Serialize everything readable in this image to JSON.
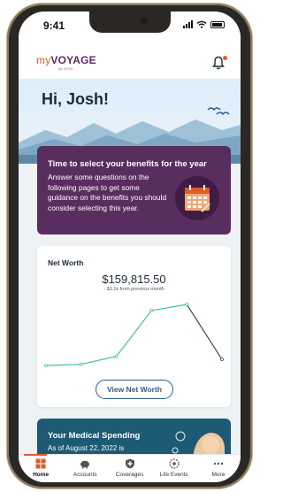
{
  "status_bar": {
    "time": "9:41"
  },
  "header": {
    "logo_my": "my",
    "logo_voyage": "VOYAGE",
    "logo_sub": "by VOYA"
  },
  "hero": {
    "greeting": "Hi, Josh!"
  },
  "benefits_card": {
    "title": "Time to select your benefits for the year",
    "text": "Answer some questions on the following pages to get some guidance on the benefits you should consider selecting this year."
  },
  "net_worth": {
    "title": "Net Worth",
    "amount": "$159,815.50",
    "change": "- $3.1k from previous month",
    "button_label": "View Net Worth"
  },
  "chart_data": {
    "type": "line",
    "title": "",
    "xlabel": "",
    "ylabel": "",
    "grid": false,
    "series": [
      {
        "values": [
          10,
          12,
          25,
          100,
          110,
          20
        ]
      }
    ]
  },
  "medical": {
    "title": "Your Medical Spending",
    "subtitle": "As of August 22, 2022 is"
  },
  "tabs": [
    {
      "label": "Home",
      "active": true
    },
    {
      "label": "Accounts"
    },
    {
      "label": "Coverages"
    },
    {
      "label": "Life Events"
    },
    {
      "label": "More"
    }
  ],
  "colors": {
    "accent": "#e05a2b",
    "purple": "#5a2d5f",
    "teal": "#1c5a75",
    "line": "#3cc49b",
    "button": "#2c5d8f"
  }
}
